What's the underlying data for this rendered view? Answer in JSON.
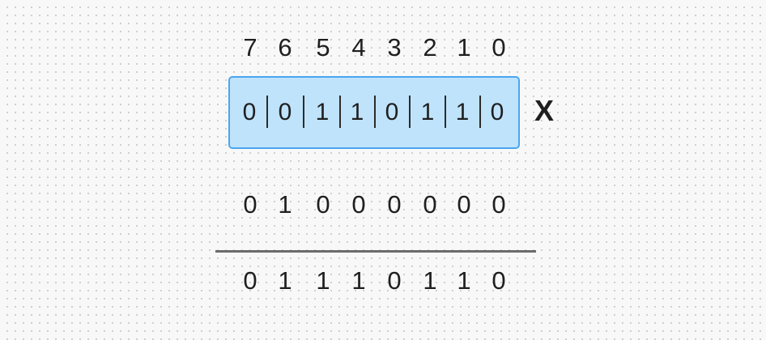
{
  "bit_positions": [
    "7",
    "6",
    "5",
    "4",
    "3",
    "2",
    "1",
    "0"
  ],
  "register_bits": [
    "0",
    "0",
    "1",
    "1",
    "0",
    "1",
    "1",
    "0"
  ],
  "operator": "X",
  "operand_bits": [
    "0",
    "1",
    "0",
    "0",
    "0",
    "0",
    "0",
    "0"
  ],
  "result_bits": [
    "0",
    "1",
    "1",
    "1",
    "0",
    "1",
    "1",
    "0"
  ],
  "colors": {
    "register_fill": "#bfe3fb",
    "register_border": "#4aa6ef",
    "divider": "#6b6b6b",
    "text": "#1f1f1f"
  }
}
